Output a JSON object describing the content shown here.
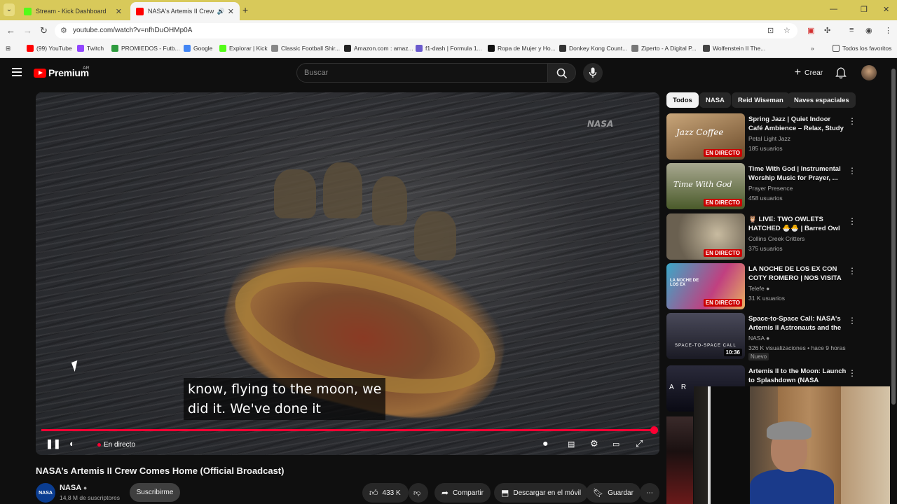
{
  "browser": {
    "tabs": [
      {
        "title": "Stream - Kick Dashboard",
        "favicon_color": "#53fc18",
        "active": false
      },
      {
        "title": "NASA's Artemis II Crew Co",
        "favicon_color": "#ff0000",
        "active": true
      }
    ],
    "url": "youtube.com/watch?v=nfhDuOHMp0A",
    "bookmarks": [
      {
        "label": "(99) YouTube",
        "color": "#ff0000"
      },
      {
        "label": "Twitch",
        "color": "#9146ff"
      },
      {
        "label": "PROMIEDOS - Futb...",
        "color": "#2e9b3e"
      },
      {
        "label": "Google",
        "color": "#4285f4"
      },
      {
        "label": "Explorar | Kick",
        "color": "#53fc18"
      },
      {
        "label": "Classic Football Shir...",
        "color": "#888888"
      },
      {
        "label": "Amazon.com : amaz...",
        "color": "#222222"
      },
      {
        "label": "f1-dash | Formula 1...",
        "color": "#6a5acd"
      },
      {
        "label": "Ropa de Mujer y Ho...",
        "color": "#111111"
      },
      {
        "label": "Donkey Kong Count...",
        "color": "#333333"
      },
      {
        "label": "Ziperto - A Digital P...",
        "color": "#777777"
      },
      {
        "label": "Wolfenstein II The...",
        "color": "#444444"
      }
    ],
    "all_favorites": "Todos los favoritos"
  },
  "header": {
    "logo": "Premium",
    "country": "AR",
    "search_placeholder": "Buscar",
    "create_label": "Crear"
  },
  "player": {
    "subtitle_lines": [
      "know, flying to the moon, we",
      "did it. We've done it"
    ],
    "live_label": "En directo",
    "watermark": "NASA",
    "progress": 1.0
  },
  "video": {
    "title": "NASA’s Artemis II Crew Comes Home (Official Broadcast)",
    "channel": "NASA",
    "channel_avatar": "NASA",
    "subscribers": "14,8 M de suscriptores",
    "subscribe_label": "Suscribirme",
    "likes": "433 K",
    "share_label": "Compartir",
    "download_label": "Descargar en el móvil",
    "save_label": "Guardar"
  },
  "chips": [
    "Todos",
    "NASA",
    "Reid Wiseman",
    "Naves espaciales"
  ],
  "recommendations": [
    {
      "title": "Spring Jazz | Quiet Indoor Café Ambience – Relax, Study & ...",
      "channel": "Petal Light Jazz",
      "meta": "185 usuarios",
      "badge": "EN DIRECTO",
      "thumb_text": "Jazz Coffee",
      "thumb_color": "#8a6a4a"
    },
    {
      "title": "Time With God | Instrumental Worship Music for Prayer, ...",
      "channel": "Prayer Presence",
      "meta": "458 usuarios",
      "badge": "EN DIRECTO",
      "thumb_text": "Time With God",
      "thumb_color": "#6a7a4a"
    },
    {
      "title": "🦉 LIVE: TWO OWLETS HATCHED 🐣🐣 | Barred Owl ...",
      "channel": "Collins Creek Critters",
      "meta": "375 usuarios",
      "badge": "EN DIRECTO",
      "thumb_text": "",
      "thumb_color": "#8a8070"
    },
    {
      "title": "LA NOCHE DE LOS EX CON COTY ROMERO | NOS VISITA ...",
      "channel": "Telefe",
      "meta": "31 K usuarios",
      "badge": "EN DIRECTO",
      "thumb_text": "LA NOCHE DE LOS EX",
      "thumb_color": "#c04080"
    },
    {
      "title": "Space-to-Space Call: NASA's Artemis II Astronauts and the ...",
      "channel": "NASA",
      "meta": "326 K visualizaciones • hace 9 horas",
      "new_label": "Nuevo",
      "duration": "10:36",
      "thumb_text": "SPACE-TO-SPACE CALL",
      "thumb_color": "#2a2a3a"
    },
    {
      "title": "Artemis II to the Moon: Launch to Splashdown (NASA Mission...",
      "channel": "",
      "meta": "",
      "thumb_text": "A R",
      "thumb_color": "#1a1a2a"
    }
  ],
  "colors": {
    "accent": "#ff0033",
    "live": "#cc0000",
    "bg": "#0f0f0f",
    "tabstrip": "#d8c95a"
  }
}
